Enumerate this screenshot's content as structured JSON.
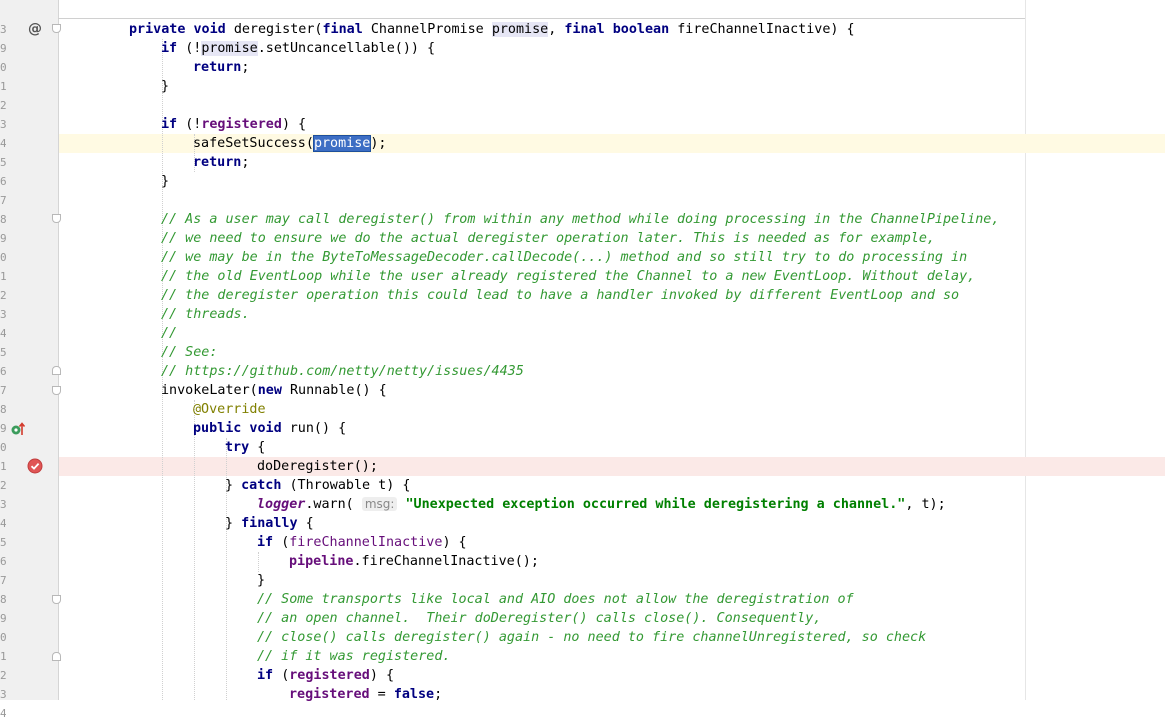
{
  "gutter": {
    "line_numbers": [
      "3",
      "9",
      "0",
      "1",
      "2",
      "3",
      "4",
      "5",
      "6",
      "7",
      "8",
      "9",
      "0",
      "1",
      "2",
      "3",
      "4",
      "5",
      "6",
      "7",
      "8",
      "9",
      "0",
      "1",
      "2",
      "3",
      "4",
      "5",
      "6",
      "7",
      "8",
      "9",
      "0",
      "1",
      "2",
      "3",
      "4"
    ]
  },
  "code": {
    "l1": {
      "kw1": "private void ",
      "t1": "deregister(",
      "kw2": "final ",
      "t2": "ChannelPromise ",
      "t3": "promise",
      "t4": ", ",
      "kw3": "final boolean ",
      "t5": "fireChannelInactive) {"
    },
    "l2": {
      "kw1": "if ",
      "t1": "(!",
      "t2": "promise",
      ".t3": "",
      "t3": ".setUncancellable()) {"
    },
    "l3": {
      "kw1": "return",
      ";": "",
      "t1": ";"
    },
    "l4": {
      "t1": "}"
    },
    "l6": {
      "kw1": "if ",
      "t1": "(!",
      "f1": "registered",
      "t2": ") {"
    },
    "l7": {
      "t1": "safeSetSuccess(",
      "sel": "promise",
      "t2": ");"
    },
    "l8": {
      "kw1": "return",
      "t1": ";"
    },
    "l9": {
      "t1": "}"
    },
    "comments": [
      "// As a user may call deregister() from within any method while doing processing in the ChannelPipeline,",
      "// we need to ensure we do the actual deregister operation later. This is needed as for example,",
      "// we may be in the ByteToMessageDecoder.callDecode(...) method and so still try to do processing in",
      "// the old EventLoop while the user already registered the Channel to a new EventLoop. Without delay,",
      "// the deregister operation this could lead to have a handler invoked by different EventLoop and so",
      "// threads.",
      "//",
      "// See:",
      "// https://github.com/netty/netty/issues/4435"
    ],
    "l20": {
      "t1": "invokeLater(",
      "kw1": "new ",
      "t2": "Runnable() {"
    },
    "l21": {
      "ann": "@Override"
    },
    "l22": {
      "kw1": "public void ",
      "t1": "run() {"
    },
    "l23": {
      "kw1": "try ",
      "t1": "{"
    },
    "l24": {
      "t1": "doDeregister();"
    },
    "l25": {
      "t1": "} ",
      "kw1": "catch ",
      "t2": "(Throwable t) {"
    },
    "l26": {
      "st": "logger",
      "t1": ".warn( ",
      "hint": "msg:",
      "str": "\"Unexpected exception occurred while deregistering a channel.\"",
      "t2": ", t);"
    },
    "l27": {
      "t1": "} ",
      "kw1": "finally ",
      "t2": "{"
    },
    "l28": {
      "kw1": "if ",
      "t1": "(",
      "f1": "fireChannelInactive",
      "t2": ") {"
    },
    "l29": {
      "f1": "pipeline",
      "t1": ".fireChannelInactive();"
    },
    "l30": {
      "t1": "}"
    },
    "comments2": [
      "// Some transports like local and AIO does not allow the deregistration of",
      "// an open channel.  Their doDeregister() calls close(). Consequently,",
      "// close() calls deregister() again - no need to fire channelUnregistered, so check",
      "// if it was registered."
    ],
    "l35": {
      "kw1": "if ",
      "t1": "(",
      "f1": "registered",
      "t2": ") {"
    },
    "l36": {
      "f1": "registered",
      "t1": " = ",
      "kw1": "false",
      "t2": ";"
    }
  },
  "icons": {
    "at": "@",
    "override": "override-up-arrow-icon",
    "breakpoint": "breakpoint-check-icon"
  },
  "colors": {
    "keyword": "#000080",
    "field": "#660e7a",
    "comment": "#339933",
    "string": "#008000",
    "annotation": "#808000",
    "caret_row": "#fffae3",
    "breakpoint_row": "#fbe9e7",
    "selection": "#3d6ec4"
  }
}
